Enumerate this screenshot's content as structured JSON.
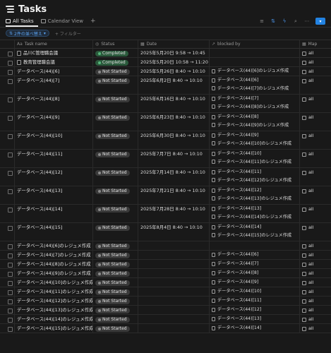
{
  "page": {
    "title": "Tasks",
    "tabs": [
      {
        "label": "All Tasks",
        "active": true
      },
      {
        "label": "Calendar View",
        "active": false
      }
    ]
  },
  "toolbar": {
    "icons": [
      "filter-icon",
      "sort-icon",
      "automation-icon",
      "search-icon",
      "more-icon"
    ],
    "new_label": "▾"
  },
  "filters": {
    "chip_label": "2件の並べ替え",
    "add_filter_label": "+ フィルター"
  },
  "columns": [
    {
      "label": "Task name",
      "icon": "Aa"
    },
    {
      "label": "Status",
      "icon": "◎"
    },
    {
      "label": "Date",
      "icon": "▦"
    },
    {
      "label": "blocked by",
      "icon": "↗"
    },
    {
      "label": "Map",
      "icon": "▦"
    }
  ],
  "rows": [
    {
      "name": "品川C管理職会議",
      "special": true,
      "status": "Completed",
      "date": "2025年5月20日 9:58 → 10:45",
      "blocked_by": [],
      "map": "all"
    },
    {
      "name": "教育管理職会議",
      "special": true,
      "status": "Completed",
      "date": "2025年5月20日 10:58 → 11:20",
      "blocked_by": [],
      "map": "all"
    },
    {
      "name": "データベース(44)[6]",
      "special": false,
      "status": "Not Started",
      "date": "2025年5月26日 8:40 → 10:10",
      "blocked_by": [
        "データベース(44)[6]のレジュメ作成"
      ],
      "map": "all"
    },
    {
      "name": "データベース(44)[7]",
      "special": false,
      "status": "Not Started",
      "date": "2025年6月2日 8:40 → 10:10",
      "blocked_by": [
        "データベース(44)[6]",
        "データベース(44)[7]のレジュメ作成"
      ],
      "map": "all"
    },
    {
      "name": "データベース(44)[8]",
      "special": false,
      "status": "Not Started",
      "date": "2025年6月16日 8:40 → 10:10",
      "blocked_by": [
        "データベース(44)[7]",
        "データベース(44)[8]のレジュメ作成"
      ],
      "map": "all"
    },
    {
      "name": "データベース(44)[9]",
      "special": false,
      "status": "Not Started",
      "date": "2025年6月23日 8:40 → 10:10",
      "blocked_by": [
        "データベース(44)[8]",
        "データベース(44)[9]のレジュメ作成"
      ],
      "map": "all"
    },
    {
      "name": "データベース(44)[10]",
      "special": false,
      "status": "Not Started",
      "date": "2025年6月30日 8:40 → 10:10",
      "blocked_by": [
        "データベース(44)[9]",
        "データベース(44)[10]のレジュメ作成"
      ],
      "map": "all"
    },
    {
      "name": "データベース(44)[11]",
      "special": false,
      "status": "Not Started",
      "date": "2025年7月7日 8:40 → 10:10",
      "blocked_by": [
        "データベース(44)[10]",
        "データベース(44)[11]のレジュメ作成"
      ],
      "map": "all"
    },
    {
      "name": "データベース(44)[12]",
      "special": false,
      "status": "Not Started",
      "date": "2025年7月14日 8:40 → 10:10",
      "blocked_by": [
        "データベース(44)[11]",
        "データベース(44)[12]のレジュメ作成"
      ],
      "map": "all"
    },
    {
      "name": "データベース(44)[13]",
      "special": false,
      "status": "Not Started",
      "date": "2025年7月21日 8:40 → 10:10",
      "blocked_by": [
        "データベース(44)[12]",
        "データベース(44)[13]のレジュメ作成"
      ],
      "map": "all"
    },
    {
      "name": "データベース(44)[14]",
      "special": false,
      "status": "Not Started",
      "date": "2025年7月28日 8:40 → 10:10",
      "blocked_by": [
        "データベース(44)[13]",
        "データベース(44)[14]のレジュメ作成"
      ],
      "map": "all"
    },
    {
      "name": "データベース(44)[15]",
      "special": false,
      "status": "Not Started",
      "date": "2025年8月4日 8:40 → 10:10",
      "blocked_by": [
        "データベース(44)[14]",
        "データベース(44)[15]のレジュメ作成"
      ],
      "map": "all"
    },
    {
      "name": "データベース(44)[6]のレジュメ作成",
      "special": false,
      "status": "Not Started",
      "date": "",
      "blocked_by": [],
      "map": "all"
    },
    {
      "name": "データベース(44)[7]のレジュメ作成",
      "special": false,
      "status": "Not Started",
      "date": "",
      "blocked_by": [
        "データベース(44)[6]"
      ],
      "map": "all"
    },
    {
      "name": "データベース(44)[8]のレジュメ作成",
      "special": false,
      "status": "Not Started",
      "date": "",
      "blocked_by": [
        "データベース(44)[7]"
      ],
      "map": "all"
    },
    {
      "name": "データベース(44)[9]のレジュメ作成",
      "special": false,
      "status": "Not Started",
      "date": "",
      "blocked_by": [
        "データベース(44)[8]"
      ],
      "map": "all"
    },
    {
      "name": "データベース(44)[10]のレジュメ作成",
      "special": false,
      "status": "Not Started",
      "date": "",
      "blocked_by": [
        "データベース(44)[9]"
      ],
      "map": "all"
    },
    {
      "name": "データベース(44)[11]のレジュメ作成",
      "special": false,
      "status": "Not Started",
      "date": "",
      "blocked_by": [
        "データベース(44)[10]"
      ],
      "map": "all"
    },
    {
      "name": "データベース(44)[12]のレジュメ作成",
      "special": false,
      "status": "Not Started",
      "date": "",
      "blocked_by": [
        "データベース(44)[11]"
      ],
      "map": "all"
    },
    {
      "name": "データベース(44)[13]のレジュメ作成",
      "special": false,
      "status": "Not Started",
      "date": "",
      "blocked_by": [
        "データベース(44)[12]"
      ],
      "map": "all"
    },
    {
      "name": "データベース(44)[14]のレジュメ作成",
      "special": false,
      "status": "Not Started",
      "date": "",
      "blocked_by": [
        "データベース(44)[13]"
      ],
      "map": "all"
    },
    {
      "name": "データベース(44)[15]のレジュメ作成",
      "special": false,
      "status": "Not Started",
      "date": "",
      "blocked_by": [
        "データベース(44)[14]"
      ],
      "map": "all"
    }
  ]
}
